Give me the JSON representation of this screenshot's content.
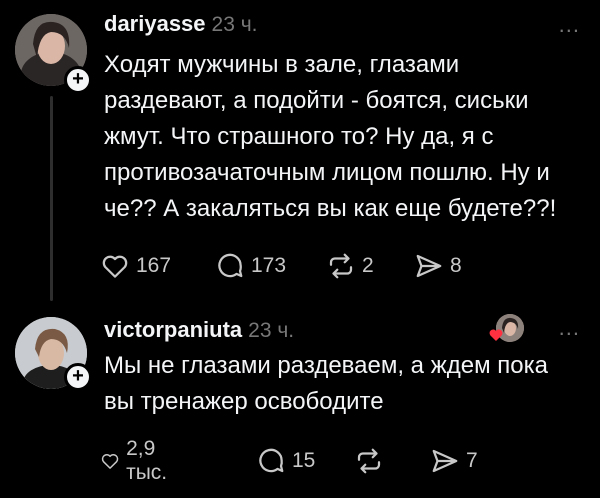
{
  "posts": [
    {
      "username": "dariyasse",
      "time": "23 ч.",
      "more": "...",
      "text": "Ходят мужчины в зале, глазами раздевают, а подойти - боятся, сиськи жмут. Что страшного то? Ну да, я с противозачаточным лицом пошлю. Ну и че?? А закаляться вы как еще будете??!",
      "likes": "167",
      "comments": "173",
      "reposts": "2",
      "shares": "8"
    },
    {
      "username": "victorpaniuta",
      "time": "23 ч.",
      "more": "...",
      "text": "Мы не глазами раздеваем, а ждем пока вы тренажер освободите",
      "likes": "2,9 тыс.",
      "comments": "15",
      "reposts": "",
      "shares": "7"
    }
  ],
  "colors": {
    "background": "#000000",
    "text": "#f3f5f7",
    "muted": "#777777",
    "heart": "#ff3040"
  },
  "icons": [
    "plus-icon",
    "heart-icon",
    "comment-icon",
    "repost-icon",
    "share-icon",
    "more-icon"
  ]
}
